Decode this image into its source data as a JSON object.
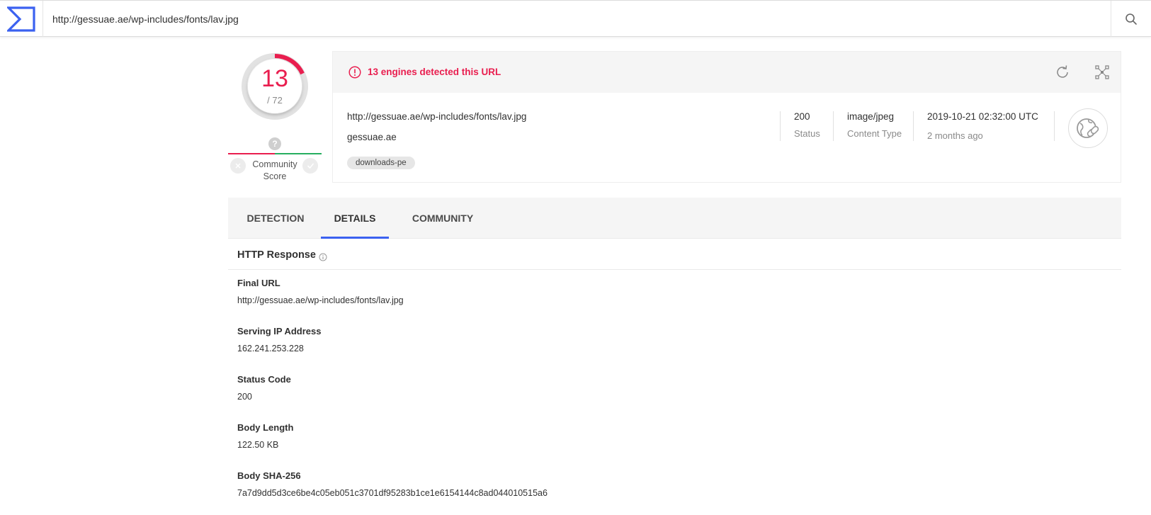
{
  "search": {
    "value": "http://gessuae.ae/wp-includes/fonts/lav.jpg"
  },
  "score": {
    "detections": "13",
    "total": "/ 72",
    "fraction": 0.1806
  },
  "community": {
    "label_line1": "Community",
    "label_line2": "Score",
    "question": "?"
  },
  "summary": {
    "alert": "13 engines detected this URL",
    "url": "http://gessuae.ae/wp-includes/fonts/lav.jpg",
    "domain": "gessuae.ae",
    "tag": "downloads-pe",
    "status_value": "200",
    "status_label": "Status",
    "content_type_value": "image/jpeg",
    "content_type_label": "Content Type",
    "date_value": "2019-10-21 02:32:00 UTC",
    "date_relative": "2 months ago"
  },
  "tabs": [
    {
      "label": "DETECTION"
    },
    {
      "label": "DETAILS"
    },
    {
      "label": "COMMUNITY"
    }
  ],
  "details": {
    "section_title": "HTTP Response",
    "fields": [
      {
        "label": "Final URL",
        "value": "http://gessuae.ae/wp-includes/fonts/lav.jpg"
      },
      {
        "label": "Serving IP Address",
        "value": "162.241.253.228"
      },
      {
        "label": "Status Code",
        "value": "200"
      },
      {
        "label": "Body Length",
        "value": "122.50 KB"
      },
      {
        "label": "Body SHA-256",
        "value": "7a7d9dd5d3ce6be4c05eb051c3701df95283b1ce1e6154144c8ad044010515a6"
      }
    ]
  },
  "colors": {
    "accent": "#3b61f0",
    "malicious": "#e91e4f",
    "harmless": "#27ae60"
  }
}
